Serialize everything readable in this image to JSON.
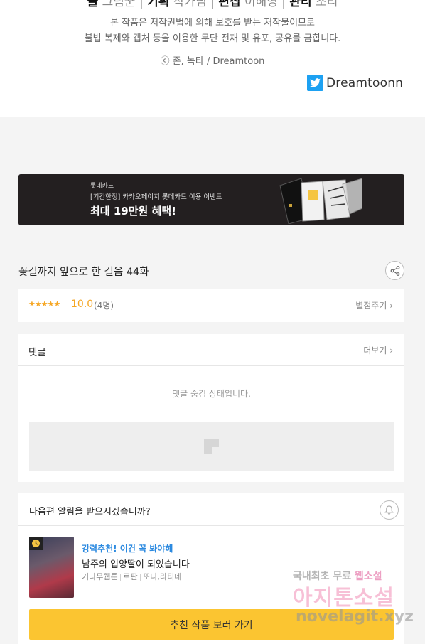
{
  "credits": {
    "role1": "글",
    "name1": "그림꾼",
    "role2": "기획",
    "name2": "작가님",
    "role3": "편집",
    "name3": "이해영",
    "role4": "관리",
    "name4": "조리"
  },
  "notice": {
    "line1": "본 작품은 저작권법에 의해 보호를 받는 저작물이므로",
    "line2": "불법 복제와 캡처 등을 이용한 무단 전재 및 유포, 공유를 금합니다."
  },
  "copyright": "ⓒ 존, 녹타 / Dreamtoon",
  "twitter": {
    "handle": "Dreamtoonn",
    "icon": "twitter-icon",
    "color": "#1da1f2"
  },
  "banner": {
    "brand": "롯데카드",
    "event": "[기간한정] 카카오페이지 롯데카드 이용 이벤트",
    "title": "최대 19만원 혜택!",
    "card_label": "롯데카드"
  },
  "episode": {
    "title": "꽃길까지 앞으로 한 걸음 44화",
    "share_icon": "share-icon"
  },
  "rating": {
    "stars": "★★★★★",
    "score": "10.0",
    "count": "(4명)",
    "rate_link": "별점주기 ›"
  },
  "comments": {
    "heading": "댓글",
    "more_link": "더보기 ›",
    "hidden_text": "댓글 숨김 상태입니다."
  },
  "notify": {
    "question": "다음편 알림을 받으시겠습니까?",
    "bell_icon": "bell-icon",
    "rec_tag": "강력추천! 이건 꼭 봐야해",
    "rec_title": "남주의 입양딸이 되었습니다",
    "rec_genre1": "기다무웹툰",
    "rec_genre2": "로판",
    "rec_authors": "또나,라티네",
    "cta_label": "추천 작품 보러 가기"
  },
  "watermark": {
    "line1a": "국내최초 무료 ",
    "line1b": "웹소설",
    "line2": "아지톤소설",
    "line3": "novelagit.xyz"
  },
  "colors": {
    "accent_yellow": "#fbc531",
    "star_orange": "#f5a623",
    "tag_blue": "#2c8ae0",
    "banner_bg": "#231f20"
  }
}
